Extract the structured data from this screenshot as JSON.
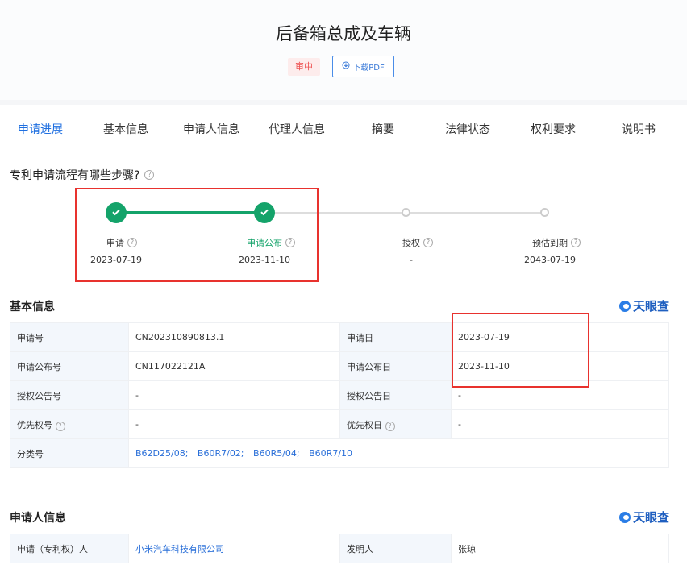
{
  "header": {
    "title": "后备箱总成及车辆",
    "status": "审中",
    "pdf_button": "下载PDF"
  },
  "tabs": [
    "申请进展",
    "基本信息",
    "申请人信息",
    "代理人信息",
    "摘要",
    "法律状态",
    "权利要求",
    "说明书"
  ],
  "progress": {
    "question": "专利申请流程有哪些步骤?",
    "steps": [
      {
        "label": "申请",
        "date": "2023-07-19",
        "done": true
      },
      {
        "label": "申请公布",
        "date": "2023-11-10",
        "done": true
      },
      {
        "label": "授权",
        "date": "-",
        "done": false
      },
      {
        "label": "预估到期",
        "date": "2043-07-19",
        "done": false
      }
    ],
    "colors": {
      "done": "#14a36a",
      "pending": "#cccccc"
    }
  },
  "basic": {
    "title": "基本信息",
    "brand": "天眼查",
    "rows": [
      {
        "l1": "申请号",
        "v1": "CN202310890813.1",
        "l2": "申请日",
        "v2": "2023-07-19"
      },
      {
        "l1": "申请公布号",
        "v1": "CN117022121A",
        "l2": "申请公布日",
        "v2": "2023-11-10"
      },
      {
        "l1": "授权公告号",
        "v1": "-",
        "l2": "授权公告日",
        "v2": "-"
      },
      {
        "l1": "优先权号",
        "v1": "-",
        "l2": "优先权日",
        "v2": "-"
      }
    ],
    "class_label": "分类号",
    "classes": [
      "B62D25/08;",
      "B60R7/02;",
      "B60R5/04;",
      "B60R7/10"
    ]
  },
  "applicant": {
    "title": "申请人信息",
    "brand": "天眼查",
    "l1": "申请（专利权）人",
    "v1": "小米汽车科技有限公司",
    "l2": "发明人",
    "v2": "张琼"
  },
  "accent_color": "#1f6fe0",
  "highlight_color": "#e8322e"
}
